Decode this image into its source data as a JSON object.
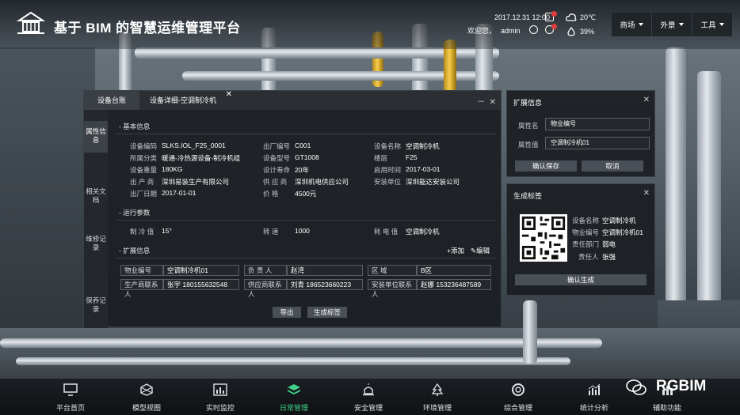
{
  "header": {
    "title": "基于 BIM 的智慧运维管理平台",
    "datetime": "2017.12.31 12:00",
    "welcome": "欢迎您，",
    "user": "admin",
    "temperature": "20℃",
    "humidity": "39%",
    "menu": [
      "商场",
      "外景",
      "工具"
    ]
  },
  "panel": {
    "tabs": [
      "设备台账",
      "设备详细-空调制冷机"
    ],
    "side_tabs": [
      "属性信息",
      "相关文档",
      "维修记录",
      "保养记录"
    ],
    "basic": {
      "section": "- 基本信息",
      "rows": [
        [
          [
            "设备编码",
            "SLKS.IOL_F25_0001"
          ],
          [
            "出厂编号",
            "C001"
          ],
          [
            "设备名称",
            "空调制冷机"
          ]
        ],
        [
          [
            "所属分类",
            "暖通-冷热源设备-制冷机组"
          ],
          [
            "设备型号",
            "GT1008"
          ],
          [
            "楼层",
            "F25"
          ]
        ],
        [
          [
            "设备重量",
            "180KG"
          ],
          [
            "设计寿命",
            "20年"
          ],
          [
            "启用时间",
            "2017-03-01"
          ]
        ],
        [
          [
            "出 产 商",
            "深圳易装生产有限公司"
          ],
          [
            "供 应 商",
            "深圳机电供应公司"
          ],
          [
            "安装单位",
            "深圳能达安装公司"
          ]
        ],
        [
          [
            "出厂日期",
            "2017-01-01"
          ],
          [
            "价    格",
            "4500元"
          ],
          [
            "",
            ""
          ]
        ]
      ]
    },
    "run": {
      "section": "- 运行参数",
      "items": [
        [
          "制 冷 值",
          "15°"
        ],
        [
          "转    速",
          "1000"
        ],
        [
          "耗 电 值",
          "空调制冷机"
        ]
      ]
    },
    "ext": {
      "section": "- 扩展信息",
      "add": "+添加",
      "edit": "编辑",
      "rows": [
        [
          [
            "物业编号",
            "空调制冷机01"
          ],
          [
            "负 责 人",
            "赵湾"
          ],
          [
            "区    域",
            "B区"
          ]
        ],
        [
          [
            "生产商联系人",
            "张宇  180155632548"
          ],
          [
            "供应商联系人",
            "刘青  186523660223"
          ],
          [
            "安装单位联系人",
            "赵娜  153236487589"
          ]
        ]
      ]
    },
    "buttons": [
      "导出",
      "生成标签"
    ]
  },
  "ext_panel": {
    "title": "扩展信息",
    "name_label": "属性名",
    "name_value": "物业编号",
    "value_label": "属性值",
    "value_value": "空调制冷机01",
    "save": "确认保存",
    "cancel": "取消"
  },
  "label_panel": {
    "title": "生成标签",
    "fields": [
      [
        "设备名称",
        "空调制冷机"
      ],
      [
        "物业编号",
        "空调制冷机01"
      ],
      [
        "责任部门",
        "弱电"
      ],
      [
        "责任人",
        "张强"
      ]
    ],
    "confirm": "确认生成"
  },
  "nav": [
    "平台首页",
    "模型视图",
    "实时监控",
    "日常管理",
    "安全管理",
    "环境管理",
    "综合管理",
    "统计分析",
    "辅助功能"
  ],
  "nav_active": "日常管理",
  "watermark": "RGBIM",
  "colors": {
    "accent_green": "#3fd38b",
    "badge_red": "#e23b3b"
  }
}
